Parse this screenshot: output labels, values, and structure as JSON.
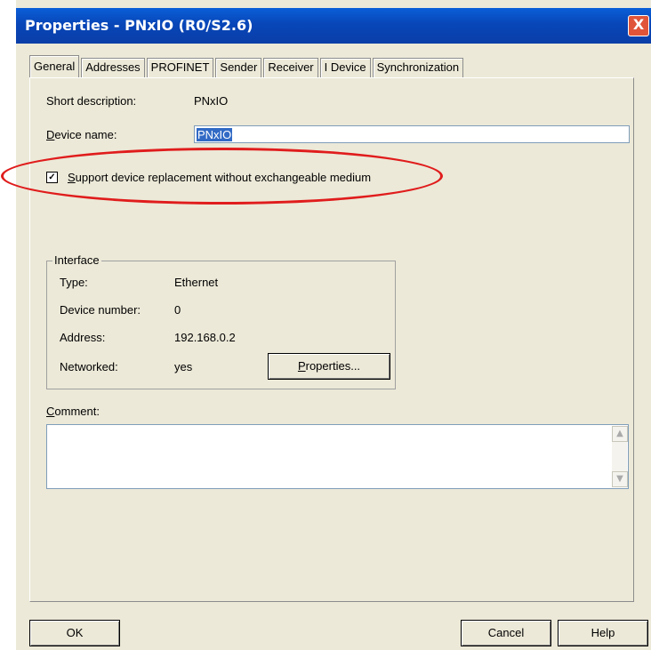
{
  "window": {
    "title": "Properties - PNxIO (R0/S2.6)",
    "close_glyph": "X"
  },
  "tabs": [
    "General",
    "Addresses",
    "PROFINET",
    "Sender",
    "Receiver",
    "I Device",
    "Synchronization"
  ],
  "general": {
    "short_description_label": "Short description:",
    "short_description_value": "PNxIO",
    "device_name_label_u": "D",
    "device_name_label_rest": "evice name:",
    "device_name_value": "PNxIO",
    "checkbox_label_u": "S",
    "checkbox_label_rest": "upport device replacement without exchangeable medium",
    "checkbox_checked": true
  },
  "interface": {
    "title": "Interface",
    "type_label": "Type:",
    "type_value": "Ethernet",
    "device_number_label": "Device number:",
    "device_number_value": "0",
    "address_label": "Address:",
    "address_value": "192.168.0.2",
    "networked_label": "Networked:",
    "networked_value": "yes",
    "properties_button_u": "P",
    "properties_button_rest": "roperties..."
  },
  "comment": {
    "label_u": "C",
    "label_rest": "omment:"
  },
  "buttons": {
    "ok": "OK",
    "cancel": "Cancel",
    "help": "Help"
  },
  "colors": {
    "highlight_ellipse": "#e01c1c",
    "titlebar": "#0a5fd8",
    "dialog_bg": "#ece9d8"
  }
}
